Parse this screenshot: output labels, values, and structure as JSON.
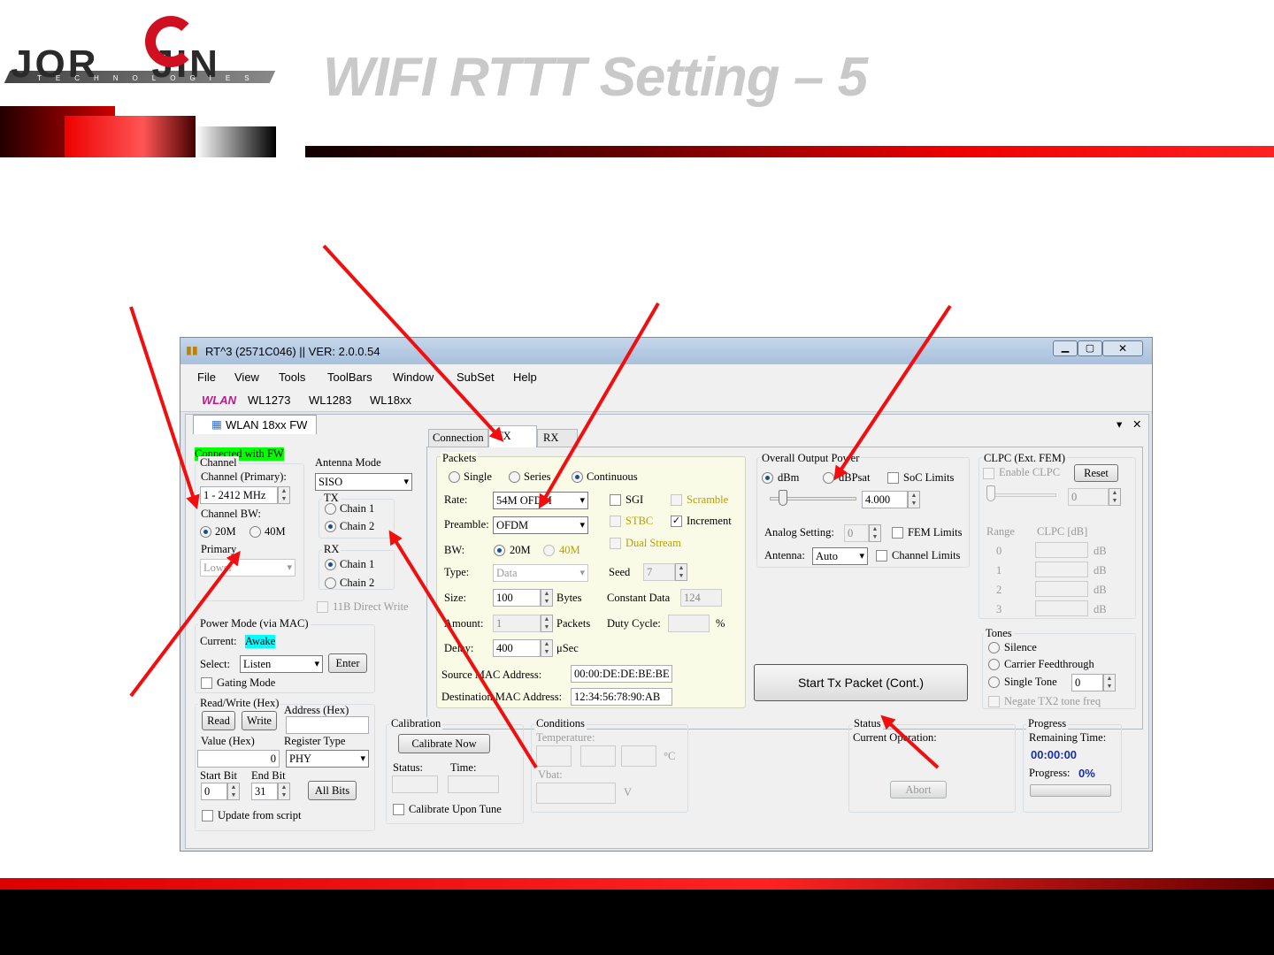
{
  "slide": {
    "title": "WIFI RTTT Setting – 5",
    "logo_text": "JOR",
    "logo_text2": "JIN",
    "logo_sub": "TECHNOLOGIES"
  },
  "colors": {
    "accent": "#e00000",
    "connected_bg": "#00ff00",
    "awake_bg": "#00ffff",
    "packets_bg": "#fafbe6"
  },
  "window": {
    "title": "RT^3 (2571C046) || VER: 2.0.0.54",
    "menu": [
      "File",
      "View",
      "Tools",
      "ToolBars",
      "Window",
      "SubSet",
      "Help"
    ],
    "toolbar": [
      "WLAN",
      "WL1273",
      "WL1283",
      "WL18xx"
    ],
    "doc_tab": "WLAN 18xx FW",
    "status_connected": "Connected with FW"
  },
  "left": {
    "channel_title": "Channel",
    "channel_primary_label": "Channel (Primary):",
    "channel_value": "1  - 2412 MHz",
    "channel_bw_label": "Channel BW:",
    "bw_20": "20M",
    "bw_40": "40M",
    "primary_label": "Primary",
    "primary_value": "Lower",
    "antenna_title": "Antenna Mode",
    "antenna_value": "SISO",
    "tx_label": "TX",
    "tx_chain1": "Chain 1",
    "tx_chain2": "Chain 2",
    "rx_label": "RX",
    "rx_chain1": "Chain 1",
    "rx_chain2": "Chain 2",
    "direct_write": "11B Direct Write",
    "power_title": "Power Mode (via MAC)",
    "current_label": "Current:",
    "current_value": "Awake",
    "select_label": "Select:",
    "select_value": "Listen",
    "enter": "Enter",
    "gating": "Gating Mode",
    "rw_title": "Read/Write (Hex)",
    "read": "Read",
    "write": "Write",
    "address_label": "Address (Hex)",
    "value_label": "Value (Hex)",
    "value_value": "0",
    "register_label": "Register Type",
    "register_value": "PHY",
    "start_bit_label": "Start Bit",
    "end_bit_label": "End Bit",
    "start_bit": "0",
    "end_bit": "31",
    "all_bits": "All Bits",
    "update_script": "Update from script"
  },
  "tabs": [
    "Connection",
    "TX",
    "RX"
  ],
  "packets": {
    "title": "Packets",
    "single": "Single",
    "series": "Series",
    "continuous": "Continuous",
    "rate_label": "Rate:",
    "rate_value": "54M OFDM",
    "sgi": "SGI",
    "scramble": "Scramble",
    "preamble_label": "Preamble:",
    "preamble_value": "OFDM",
    "stbc": "STBC",
    "increment": "Increment",
    "bw_label": "BW:",
    "bw20": "20M",
    "bw40": "40M",
    "dual_stream": "Dual Stream",
    "type_label": "Type:",
    "type_value": "Data",
    "seed_label": "Seed",
    "seed_value": "7",
    "size_label": "Size:",
    "size_value": "100",
    "bytes": "Bytes",
    "constant_label": "Constant Data",
    "constant_value": "124",
    "amount_label": "Amount:",
    "amount_value": "1",
    "packets_unit": "Packets",
    "duty_label": "Duty Cycle:",
    "duty_unit": "%",
    "delay_label": "Delay:",
    "delay_value": "400",
    "usec": "μSec",
    "src_mac_label": "Source MAC Address:",
    "src_mac": "00:00:DE:DE:BE:BE",
    "dst_mac_label": "Destination MAC Address:",
    "dst_mac": "12:34:56:78:90:AB"
  },
  "output": {
    "title": "Overall Output Power",
    "dbm": "dBm",
    "dbpsat": "dBPsat",
    "soc_limits": "SoC Limits",
    "power_value": "4.000",
    "analog_label": "Analog Setting:",
    "analog_value": "0",
    "fem_limits": "FEM Limits",
    "antenna_label": "Antenna:",
    "antenna_value": "Auto",
    "channel_limits": "Channel Limits"
  },
  "clpc": {
    "title": "CLPC (Ext. FEM)",
    "enable": "Enable CLPC",
    "reset": "Reset",
    "value": "0",
    "range_label": "Range",
    "clpc_db_label": "CLPC [dB]",
    "rows": [
      "0",
      "1",
      "2",
      "3"
    ],
    "unit": "dB"
  },
  "tones": {
    "title": "Tones",
    "silence": "Silence",
    "carrier": "Carrier Feedthrough",
    "single": "Single Tone",
    "single_value": "0",
    "negate": "Negate TX2 tone freq"
  },
  "start_button": "Start Tx Packet (Cont.)",
  "calibration": {
    "title": "Calibration",
    "button": "Calibrate Now",
    "status_label": "Status:",
    "time_label": "Time:",
    "upon_tune": "Calibrate Upon Tune"
  },
  "conditions": {
    "title": "Conditions",
    "temperature_label": "Temperature:",
    "celsius": "°C",
    "vbat_label": "Vbat:",
    "volt": "V"
  },
  "status": {
    "title": "Status",
    "current_op": "Current Operation:",
    "abort": "Abort"
  },
  "progress": {
    "title": "Progress",
    "remaining_label": "Remaining Time:",
    "remaining_value": "00:00:00",
    "progress_label": "Progress:",
    "progress_value": "0%",
    "fraction": 0
  }
}
